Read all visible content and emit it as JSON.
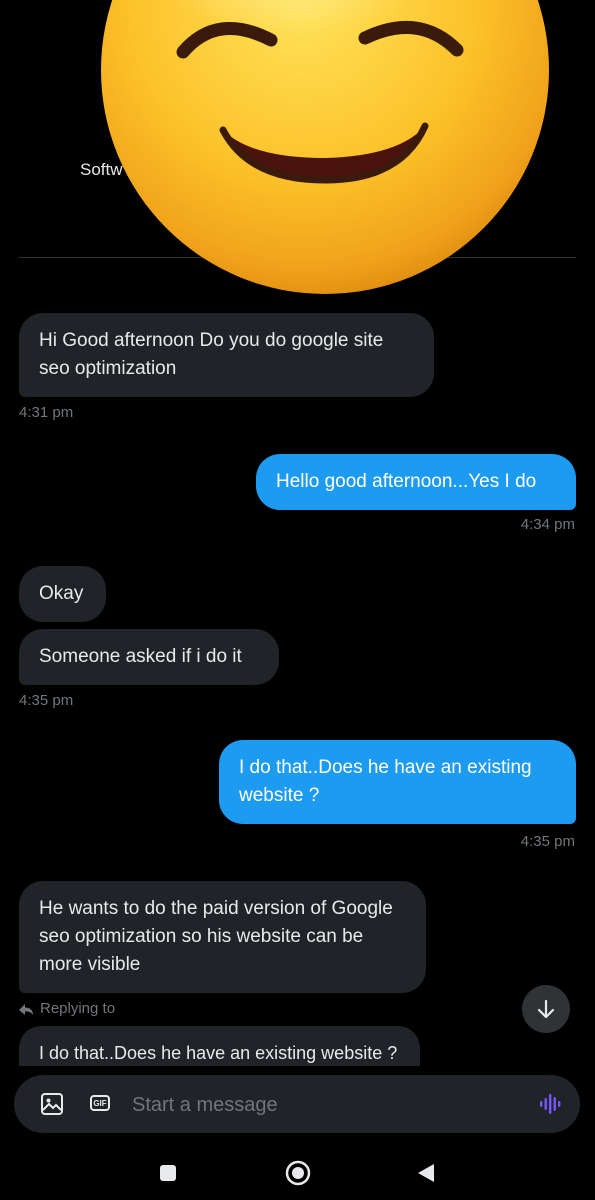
{
  "profile": {
    "subtitle": "Softw"
  },
  "messages": [
    {
      "dir": "in",
      "text": "Hi Good afternoon Do you do google site seo optimization"
    },
    {
      "time": "4:31 pm"
    },
    {
      "dir": "out",
      "text": "Hello good afternoon...Yes I do"
    },
    {
      "time": "4:34 pm"
    },
    {
      "dir": "in",
      "text": "Okay"
    },
    {
      "dir": "in",
      "text": "Someone asked if i do it"
    },
    {
      "time": "4:35 pm"
    },
    {
      "dir": "out",
      "text": "I do that..Does he have an existing website ?"
    },
    {
      "time": "4:35 pm"
    },
    {
      "dir": "in",
      "text": "He wants to do the paid version of Google  seo optimization so his website can be more visible"
    }
  ],
  "reply": {
    "label": "Replying to",
    "quoted": "I do that..Does he have an existing website ?"
  },
  "composer": {
    "placeholder": "Start a message"
  },
  "colors": {
    "accent": "#1d9bf0",
    "incoming": "#202327",
    "background": "#000000",
    "voice": "#7856ff"
  },
  "icons": [
    "emoji-sticker",
    "arrow-down-icon",
    "image-icon",
    "gif-icon",
    "voice-icon",
    "reply-arrow-icon",
    "nav-recents-icon",
    "nav-home-icon",
    "nav-back-icon"
  ]
}
